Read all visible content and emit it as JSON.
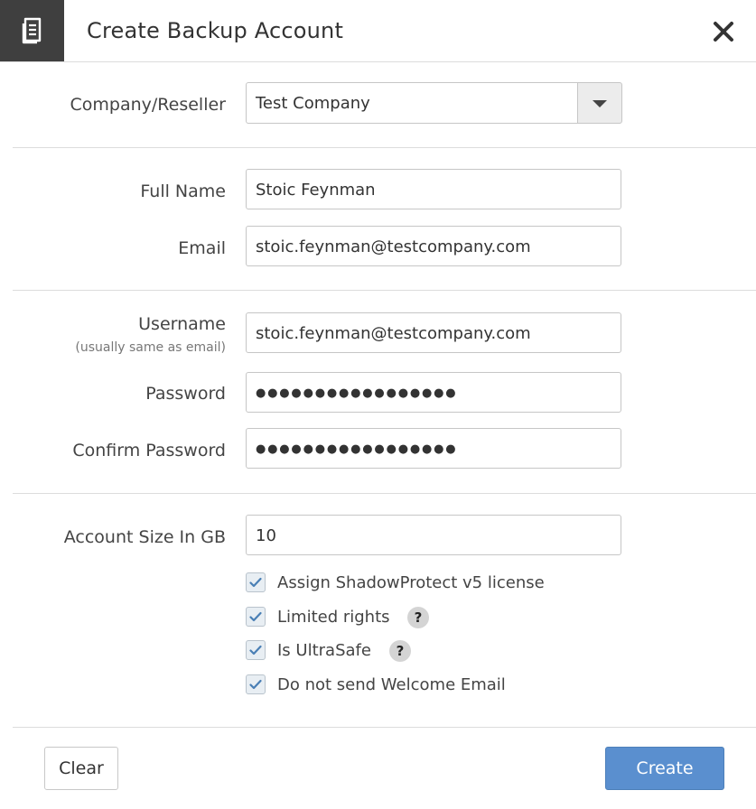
{
  "dialog": {
    "title": "Create Backup Account",
    "header_icon": "document-icon",
    "close_icon": "close-icon"
  },
  "form": {
    "company": {
      "label": "Company/Reseller",
      "value": "Test Company"
    },
    "full_name": {
      "label": "Full Name",
      "value": "Stoic Feynman"
    },
    "email": {
      "label": "Email",
      "value": "stoic.feynman@testcompany.com"
    },
    "username": {
      "label": "Username",
      "sublabel": "(usually same as email)",
      "value": "stoic.feynman@testcompany.com"
    },
    "password": {
      "label": "Password",
      "value": "●●●●●●●●●●●●●●●●●"
    },
    "confirm_password": {
      "label": "Confirm Password",
      "value": "●●●●●●●●●●●●●●●●●"
    },
    "account_size": {
      "label": "Account Size In GB",
      "value": "10"
    },
    "checkboxes": [
      {
        "label": "Assign ShadowProtect v5 license",
        "checked": true,
        "help": false
      },
      {
        "label": "Limited rights",
        "checked": true,
        "help": true
      },
      {
        "label": "Is UltraSafe",
        "checked": true,
        "help": true
      },
      {
        "label": "Do not send Welcome Email",
        "checked": true,
        "help": false
      }
    ],
    "help_glyph": "?"
  },
  "footer": {
    "clear_label": "Clear",
    "create_label": "Create"
  },
  "colors": {
    "header_icon_bg": "#3f3f3f",
    "primary_button": "#5a8fcf",
    "checkbox_bg": "#e8eef3",
    "check_mark": "#4a7fb5"
  }
}
